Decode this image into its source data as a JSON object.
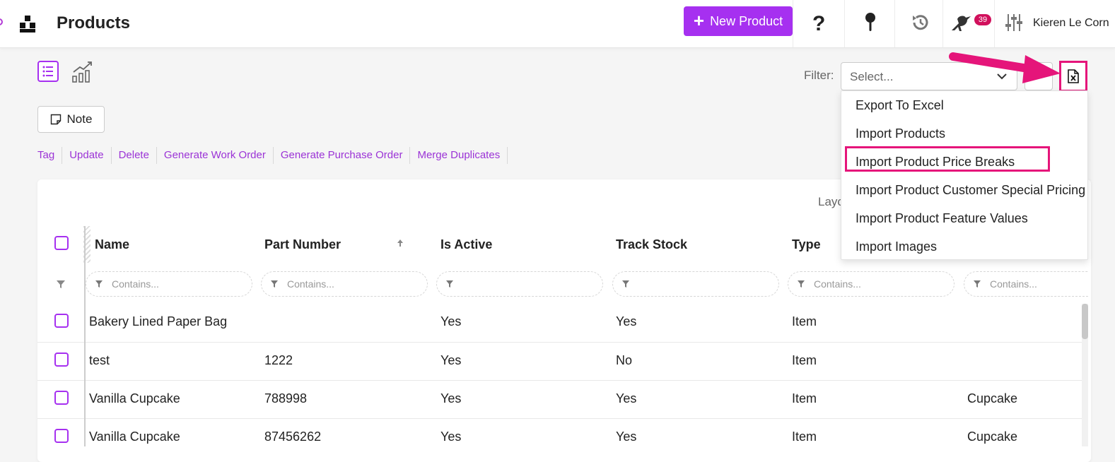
{
  "header": {
    "title": "Products",
    "new_product_label": "New Product",
    "notification_count": "39",
    "user_name": "Kieren Le Corn"
  },
  "toolbar": {
    "filter_label": "Filter:",
    "filter_placeholder": "Select...",
    "note_label": "Note",
    "layout_label": "Layo"
  },
  "actions": [
    "Tag",
    "Update",
    "Delete",
    "Generate Work Order",
    "Generate Purchase Order",
    "Merge Duplicates"
  ],
  "export_menu": {
    "items": [
      "Export To Excel",
      "Import Products",
      "Import Product Price Breaks",
      "Import Product Customer Special Pricing",
      "Import Product Feature Values",
      "Import Images"
    ],
    "highlighted_item": "Import Product Price Breaks"
  },
  "table": {
    "columns": [
      "Name",
      "Part Number",
      "Is Active",
      "Track Stock",
      "Type"
    ],
    "filter_placeholder": "Contains...",
    "rows": [
      {
        "name": "Bakery Lined Paper Bag",
        "part_number": "",
        "is_active": "Yes",
        "track_stock": "Yes",
        "type": "Item",
        "extra": ""
      },
      {
        "name": "test",
        "part_number": "1222",
        "is_active": "Yes",
        "track_stock": "No",
        "type": "Item",
        "extra": ""
      },
      {
        "name": "Vanilla Cupcake",
        "part_number": "788998",
        "is_active": "Yes",
        "track_stock": "Yes",
        "type": "Item",
        "extra": "Cupcake"
      },
      {
        "name": "Vanilla Cupcake",
        "part_number": "87456262",
        "is_active": "Yes",
        "track_stock": "Yes",
        "type": "Item",
        "extra": "Cupcake"
      }
    ]
  },
  "colors": {
    "accent": "#a630f0",
    "annotation": "#e5157a",
    "badge": "#d1105c"
  },
  "icons": [
    "app-logo-icon",
    "help-icon",
    "pin-icon",
    "history-icon",
    "bird-icon",
    "settings-sliders-icon",
    "list-view-icon",
    "chart-view-icon",
    "chevron-down-icon",
    "excel-file-icon",
    "note-icon",
    "funnel-icon",
    "sort-up-icon"
  ]
}
